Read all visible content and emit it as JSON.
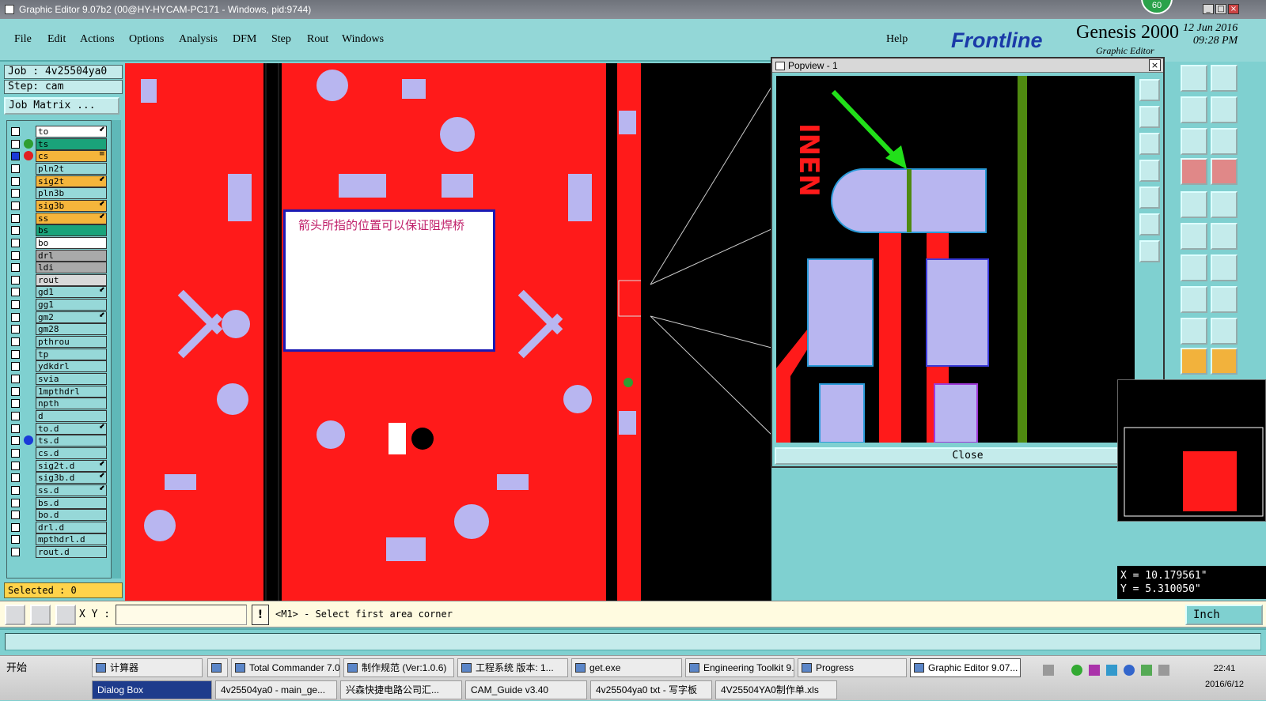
{
  "window": {
    "title": "Graphic Editor 9.07b2 (00@HY-HYCAM-PC171 - Windows, pid:9744)",
    "badge": "60",
    "minimize": "_",
    "maximize": "□",
    "close": "×"
  },
  "menu": {
    "items": [
      "File",
      "Edit",
      "Actions",
      "Options",
      "Analysis",
      "DFM",
      "Step",
      "Rout",
      "Windows"
    ],
    "help": "Help"
  },
  "logo": {
    "brand": "Frontline",
    "product": "Genesis 2000",
    "subtitle": "Graphic Editor",
    "date": "12 Jun 2016",
    "time": "09:28 PM"
  },
  "job": {
    "job_label": "Job : 4v25504ya0",
    "step_label": "Step: cam",
    "matrix_button": "Job Matrix ..."
  },
  "layers": [
    {
      "name": "to",
      "bg": "#ffffff",
      "dot": "",
      "mark": "⬋"
    },
    {
      "name": "ts",
      "bg": "#1aa37a",
      "dot": "#2e9e32",
      "mark": ""
    },
    {
      "name": "cs",
      "bg": "#f5b53b",
      "dot": "#e02020",
      "mark": "≡",
      "active": true
    },
    {
      "name": "pln2t",
      "bg": "#96d8d8",
      "dot": "",
      "mark": ""
    },
    {
      "name": "sig2t",
      "bg": "#f5b53b",
      "dot": "",
      "mark": "⬋"
    },
    {
      "name": "pln3b",
      "bg": "#96d8d8",
      "dot": "",
      "mark": ""
    },
    {
      "name": "sig3b",
      "bg": "#f5b53b",
      "dot": "",
      "mark": "⬋"
    },
    {
      "name": "ss",
      "bg": "#f5b53b",
      "dot": "",
      "mark": "⬋"
    },
    {
      "name": "bs",
      "bg": "#1aa37a",
      "dot": "",
      "mark": ""
    },
    {
      "name": "bo",
      "bg": "#ffffff",
      "dot": "",
      "mark": ""
    },
    {
      "name": "drl",
      "bg": "#a9a9a9",
      "dot": "",
      "mark": ""
    },
    {
      "name": "ldi",
      "bg": "#a9a9a9",
      "dot": "",
      "mark": ""
    },
    {
      "name": "rout",
      "bg": "#d9d9d9",
      "dot": "",
      "mark": ""
    },
    {
      "name": "gd1",
      "bg": "#96d8d8",
      "dot": "",
      "mark": "⬋"
    },
    {
      "name": "gg1",
      "bg": "#96d8d8",
      "dot": "",
      "mark": ""
    },
    {
      "name": "gm2",
      "bg": "#96d8d8",
      "dot": "",
      "mark": "⬋"
    },
    {
      "name": "gm28",
      "bg": "#96d8d8",
      "dot": "",
      "mark": ""
    },
    {
      "name": "pthrou",
      "bg": "#96d8d8",
      "dot": "",
      "mark": ""
    },
    {
      "name": "tp",
      "bg": "#96d8d8",
      "dot": "",
      "mark": ""
    },
    {
      "name": "ydkdrl",
      "bg": "#96d8d8",
      "dot": "",
      "mark": ""
    },
    {
      "name": "svia",
      "bg": "#96d8d8",
      "dot": "",
      "mark": ""
    },
    {
      "name": "1mpthdrl",
      "bg": "#96d8d8",
      "dot": "",
      "mark": ""
    },
    {
      "name": "npth",
      "bg": "#96d8d8",
      "dot": "",
      "mark": ""
    },
    {
      "name": "d",
      "bg": "#96d8d8",
      "dot": "",
      "mark": ""
    },
    {
      "name": "to.d",
      "bg": "#96d8d8",
      "dot": "",
      "mark": "⬋"
    },
    {
      "name": "ts.d",
      "bg": "#96d8d8",
      "dot": "#1a3ad8",
      "mark": ""
    },
    {
      "name": "cs.d",
      "bg": "#96d8d8",
      "dot": "",
      "mark": ""
    },
    {
      "name": "sig2t.d",
      "bg": "#96d8d8",
      "dot": "",
      "mark": "⬋"
    },
    {
      "name": "sig3b.d",
      "bg": "#96d8d8",
      "dot": "",
      "mark": "⬋"
    },
    {
      "name": "ss.d",
      "bg": "#96d8d8",
      "dot": "",
      "mark": "⬋"
    },
    {
      "name": "bs.d",
      "bg": "#96d8d8",
      "dot": "",
      "mark": ""
    },
    {
      "name": "bo.d",
      "bg": "#96d8d8",
      "dot": "",
      "mark": ""
    },
    {
      "name": "drl.d",
      "bg": "#96d8d8",
      "dot": "",
      "mark": ""
    },
    {
      "name": "mpthdrl.d",
      "bg": "#96d8d8",
      "dot": "",
      "mark": ""
    },
    {
      "name": "rout.d",
      "bg": "#96d8d8",
      "dot": "",
      "mark": ""
    }
  ],
  "selected": "Selected : 0",
  "note": {
    "text": "箭头所指的位置可以保证阻焊桥"
  },
  "popview": {
    "title": "Popview - 1",
    "close_x": "×",
    "close_label": "Close",
    "board_text": "INEN"
  },
  "coords": {
    "x": "X = 10.179561\"",
    "y": "Y = 5.310050\""
  },
  "commandbar": {
    "xy_label": "X Y :",
    "xy_value": "",
    "excl": "!",
    "message": "<M1> - Select first area corner",
    "unit": "Inch"
  },
  "taskbar": {
    "start": "开始",
    "row1": [
      "计算器",
      "",
      "Total Commander 7.0...",
      "制作规范 (Ver:1.0.6)",
      "工程系统  版本: 1...",
      "get.exe",
      "Engineering Toolkit 9....",
      "Progress",
      "Graphic Editor 9.07..."
    ],
    "row2": [
      "Dialog Box",
      "4v25504ya0 - main_ge...",
      "兴森快捷电路公司汇...",
      "CAM_Guide v3.40",
      "4v25504ya0 txt - 写字板",
      "4V25504YA0制作单.xls"
    ],
    "time": "22:41",
    "date": "2016/6/12"
  },
  "colors": {
    "copper": "#ff1a1a",
    "pad": "#b8b6f0",
    "panel": "#7fd0d0",
    "arrow": "#22e01a"
  }
}
